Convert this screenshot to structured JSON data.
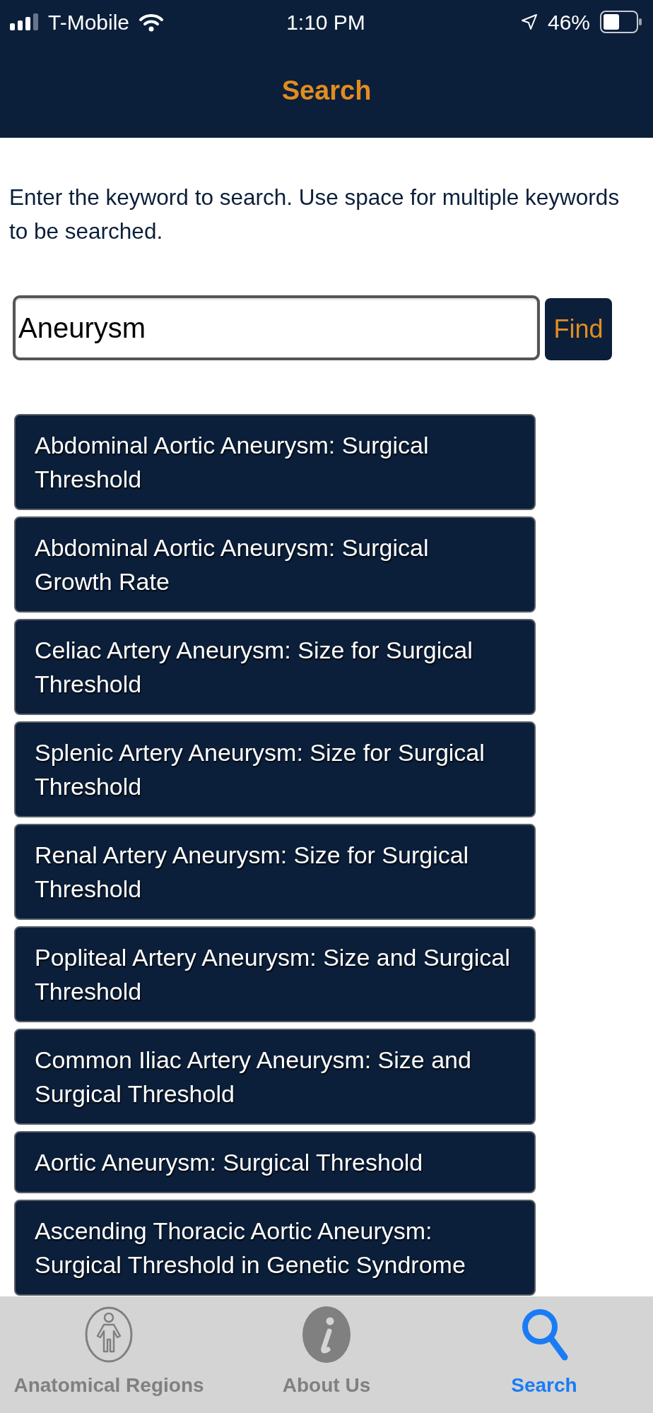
{
  "status_bar": {
    "carrier": "T-Mobile",
    "time": "1:10 PM",
    "battery": "46%"
  },
  "header": {
    "title": "Search"
  },
  "instructions": "Enter the keyword to search. Use space for multiple keywords to be searched.",
  "search": {
    "value": "Aneurysm",
    "button": "Find"
  },
  "results": [
    "Abdominal Aortic Aneurysm: Surgical Threshold",
    "Abdominal Aortic Aneurysm: Surgical Growth Rate",
    "Celiac Artery Aneurysm: Size for Surgical Threshold",
    "Splenic Artery Aneurysm: Size for Surgical Threshold",
    "Renal Artery Aneurysm: Size for Surgical Threshold",
    "Popliteal Artery Aneurysm: Size and Surgical Threshold",
    "Common Iliac Artery Aneurysm: Size and Surgical Threshold",
    "Aortic Aneurysm: Surgical Threshold",
    "Ascending Thoracic Aortic Aneurysm: Surgical Threshold in Genetic Syndrome"
  ],
  "tab_bar": [
    {
      "label": "Anatomical Regions",
      "selected": false
    },
    {
      "label": "About Us",
      "selected": false
    },
    {
      "label": "Search",
      "selected": true
    }
  ]
}
